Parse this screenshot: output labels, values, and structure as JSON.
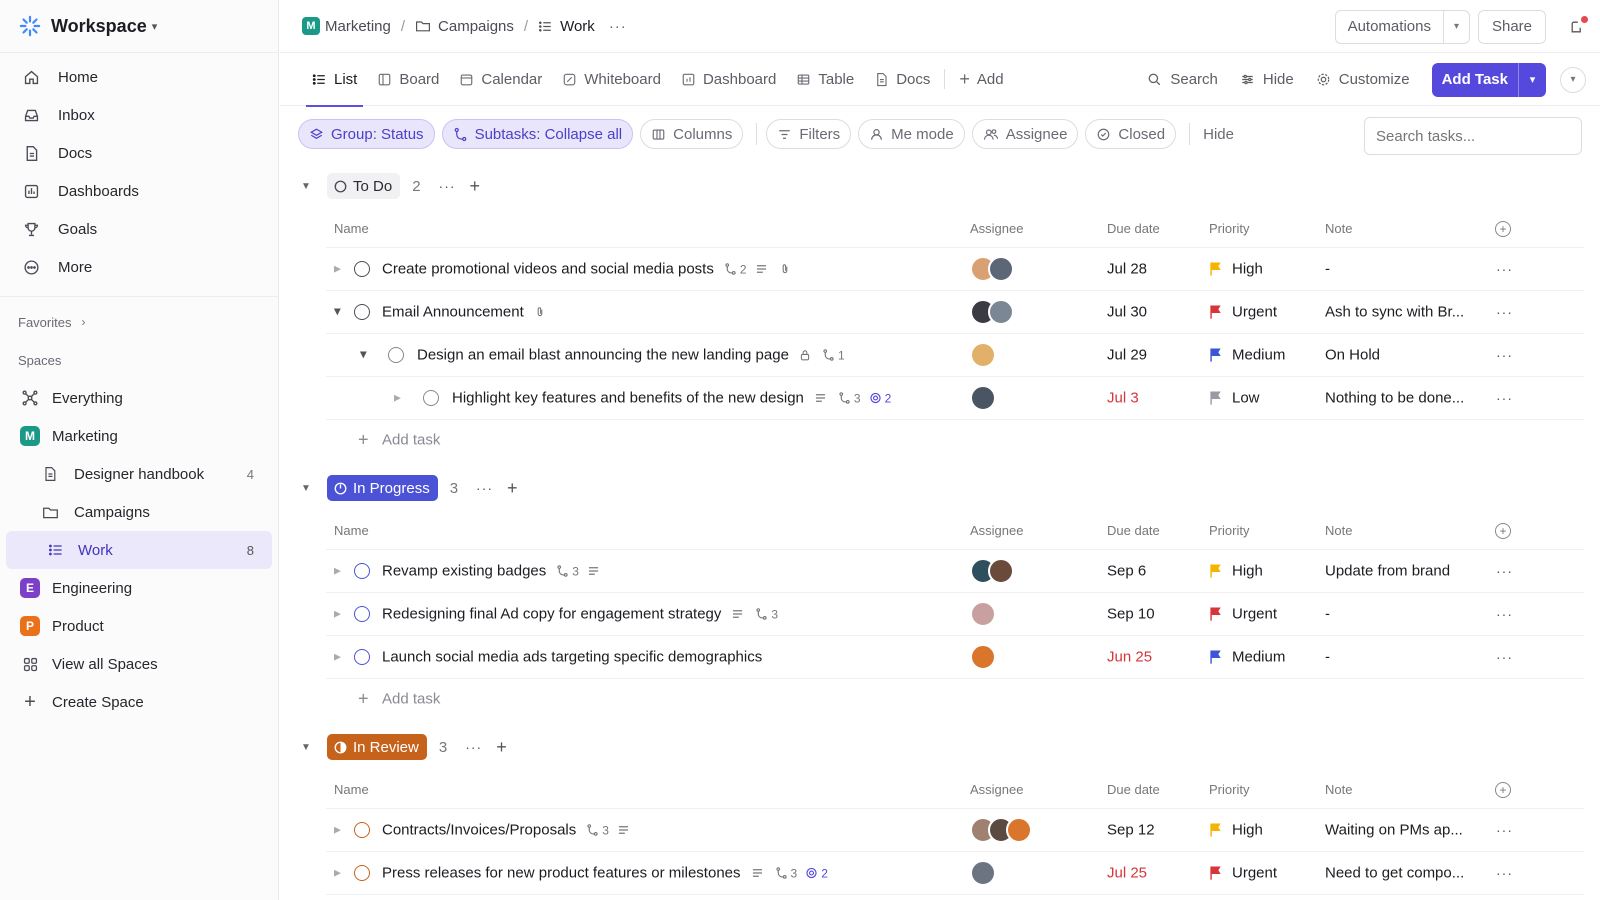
{
  "workspace": {
    "name": "Workspace"
  },
  "nav": [
    {
      "label": "Home",
      "icon": "home-icon"
    },
    {
      "label": "Inbox",
      "icon": "inbox-icon"
    },
    {
      "label": "Docs",
      "icon": "docs-icon"
    },
    {
      "label": "Dashboards",
      "icon": "dashboards-icon"
    },
    {
      "label": "Goals",
      "icon": "goals-icon"
    },
    {
      "label": "More",
      "icon": "more-icon"
    }
  ],
  "favorites_label": "Favorites",
  "spaces_label": "Spaces",
  "spaces": {
    "everything": "Everything",
    "marketing": {
      "label": "Marketing",
      "initial": "M",
      "color": "#1a9a86"
    },
    "designer_handbook": {
      "label": "Designer handbook",
      "count": "4"
    },
    "campaigns": {
      "label": "Campaigns"
    },
    "work": {
      "label": "Work",
      "count": "8"
    },
    "engineering": {
      "label": "Engineering",
      "initial": "E",
      "color": "#7c3fc8"
    },
    "product": {
      "label": "Product",
      "initial": "P",
      "color": "#e8711a"
    },
    "view_all": "View all Spaces",
    "create": "Create Space"
  },
  "breadcrumb": {
    "space": "Marketing",
    "space_initial": "M",
    "folder": "Campaigns",
    "list": "Work",
    "sep": "/"
  },
  "topbar": {
    "automations": "Automations",
    "share": "Share"
  },
  "views": {
    "tabs": [
      "List",
      "Board",
      "Calendar",
      "Whiteboard",
      "Dashboard",
      "Table",
      "Docs"
    ],
    "add": "Add",
    "search": "Search",
    "hide": "Hide",
    "customize": "Customize",
    "add_task": "Add Task"
  },
  "filters": {
    "group": "Group: Status",
    "subtasks": "Subtasks: Collapse all",
    "columns": "Columns",
    "filters": "Filters",
    "me_mode": "Me mode",
    "assignee": "Assignee",
    "closed": "Closed",
    "hide": "Hide",
    "search_placeholder": "Search tasks..."
  },
  "columns": {
    "name": "Name",
    "assignee": "Assignee",
    "due": "Due date",
    "priority": "Priority",
    "note": "Note"
  },
  "add_task_label": "Add task",
  "groups": [
    {
      "label": "To Do",
      "count": "2",
      "style": "todo",
      "rows": [
        {
          "name": "Create promotional videos and social media posts",
          "subtasks": "2",
          "due": "Jul 28",
          "late": false,
          "priority": "High",
          "priority_color": "#f5b400",
          "note": "-"
        },
        {
          "name": "Email Announcement",
          "due": "Jul 30",
          "late": false,
          "priority": "Urgent",
          "priority_color": "#d6363a",
          "note": "Ash to sync with Br..."
        },
        {
          "name": "Design an email blast announcing the new landing page",
          "subtasks": "1",
          "due": "Jul 29",
          "late": false,
          "priority": "Medium",
          "priority_color": "#3a55d6",
          "note": "On Hold"
        },
        {
          "name": "Highlight key features and benefits of the new design",
          "subtasks": "3",
          "mentions": "2",
          "due": "Jul 3",
          "late": true,
          "priority": "Low",
          "priority_color": "#9a9aa3",
          "note": "Nothing to be done..."
        }
      ]
    },
    {
      "label": "In Progress",
      "count": "3",
      "style": "prog",
      "rows": [
        {
          "name": "Revamp existing badges",
          "subtasks": "3",
          "due": "Sep 6",
          "late": false,
          "priority": "High",
          "priority_color": "#f5b400",
          "note": "Update from brand"
        },
        {
          "name": "Redesigning final Ad copy for engagement strategy",
          "subtasks": "3",
          "due": "Sep 10",
          "late": false,
          "priority": "Urgent",
          "priority_color": "#d6363a",
          "note": "-"
        },
        {
          "name": "Launch social media ads targeting specific demographics",
          "due": "Jun 25",
          "late": true,
          "priority": "Medium",
          "priority_color": "#3a55d6",
          "note": "-"
        }
      ]
    },
    {
      "label": "In Review",
      "count": "3",
      "style": "rev",
      "rows": [
        {
          "name": "Contracts/Invoices/Proposals",
          "subtasks": "3",
          "due": "Sep 12",
          "late": false,
          "priority": "High",
          "priority_color": "#f5b400",
          "note": "Waiting on PMs ap..."
        },
        {
          "name": "Press releases for new product features or milestones",
          "subtasks": "3",
          "mentions": "2",
          "due": "Jul 25",
          "late": true,
          "priority": "Urgent",
          "priority_color": "#d6363a",
          "note": "Need to get compo..."
        }
      ]
    }
  ]
}
